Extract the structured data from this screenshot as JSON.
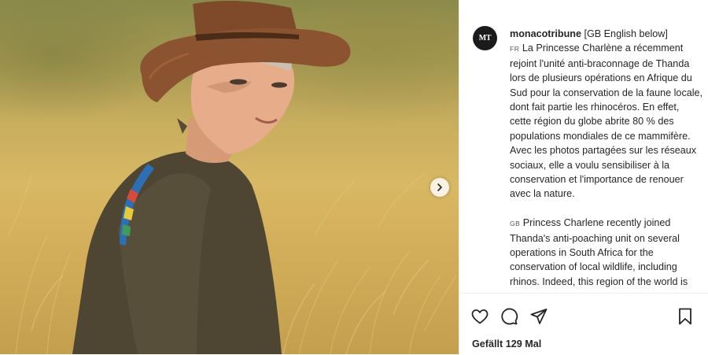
{
  "post": {
    "username": "monacotribune",
    "username_suffix": " [GB English below]",
    "avatar_initials": "MT",
    "caption_fr_flag": "FR",
    "caption_fr": "La Princesse Charlène a récemment rejoint l'unité anti-braconnage de Thanda lors de plusieurs opérations en Afrique du Sud pour la conservation de la faune locale, dont fait partie les rhinocéros. En effet, cette région du globe abrite 80 % des populations mondiales de ce mammifère. Avec les photos partagées sur les réseaux sociaux, elle a voulu sensibiliser à la conservation et l'importance de renouer avec la nature.",
    "caption_gb_flag": "GB",
    "caption_gb": "Princess Charlene recently joined Thanda's anti-poaching unit on several operations in South Africa for the conservation of local wildlife, including rhinos. Indeed, this region of the world is",
    "likes": "Gefällt 129 Mal"
  },
  "icons": {
    "like": "heart-icon",
    "comment": "comment-bubble-icon",
    "share": "paper-plane-icon",
    "save": "bookmark-icon",
    "next": "chevron-right-icon"
  }
}
